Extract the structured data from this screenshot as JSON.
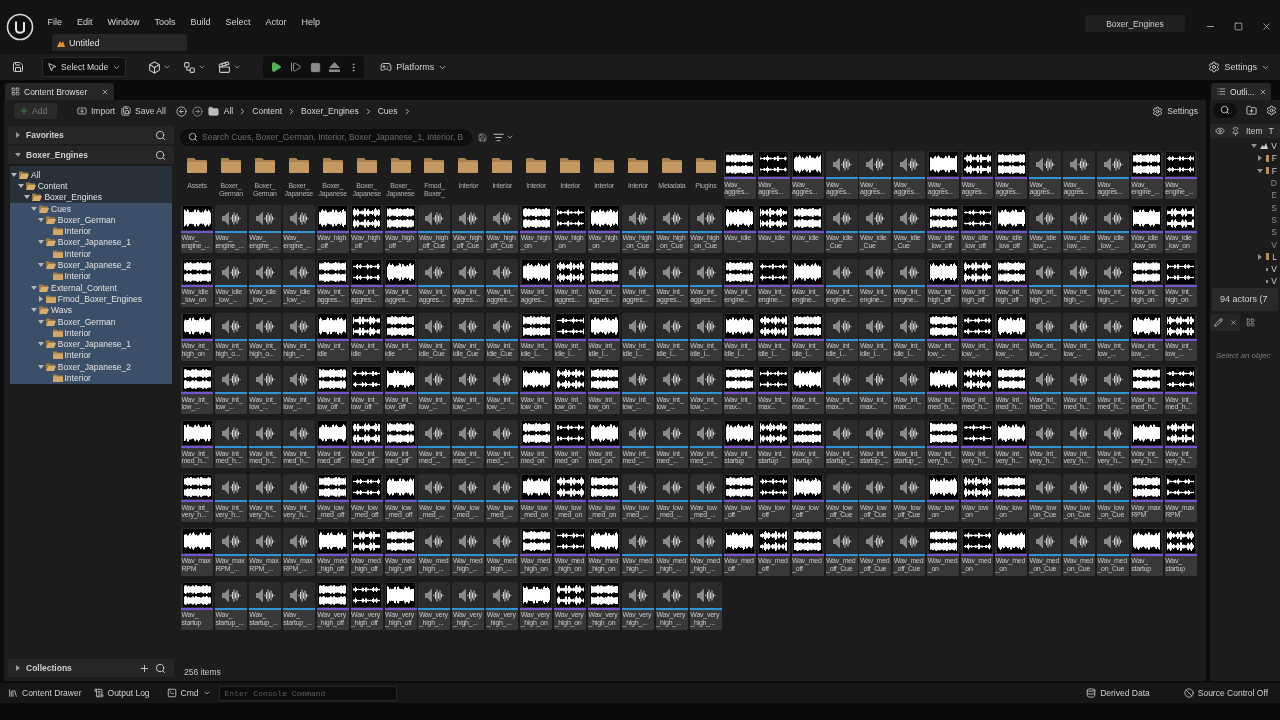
{
  "title_bar": {
    "menu": [
      "File",
      "Edit",
      "Window",
      "Tools",
      "Build",
      "Select",
      "Actor",
      "Help"
    ],
    "document_tab": "Untitled",
    "project_name": "Boxer_Engines"
  },
  "main_toolbar": {
    "mode_button": "Select Mode",
    "platforms_button": "Platforms",
    "settings_button": "Settings"
  },
  "content_browser": {
    "tab": "Content Browser",
    "toolbar": {
      "add_button": {
        "label": "Add",
        "disabled": true
      },
      "import_button": "Import",
      "save_all_button": "Save All",
      "breadcrumbs": [
        "All",
        "Content",
        "Boxer_Engines",
        "Cues"
      ],
      "settings_button": "Settings"
    },
    "sidebar": {
      "favorites_header": "Favorites",
      "tree_header": "Boxer_Engines",
      "tree": [
        {
          "label": "All",
          "expanded": true,
          "selected": false,
          "children": [
            {
              "label": "Content",
              "expanded": true,
              "selected": false,
              "children": [
                {
                  "label": "Boxer_Engines",
                  "expanded": true,
                  "selected": false,
                  "children": [
                    {
                      "label": "Cues",
                      "expanded": true,
                      "selected": true,
                      "children": [
                        {
                          "label": "Boxer_German",
                          "expanded": true,
                          "selected": true,
                          "children": [
                            {
                              "label": "Interior",
                              "selected": true
                            }
                          ]
                        },
                        {
                          "label": "Boxer_Japanese_1",
                          "expanded": true,
                          "selected": true,
                          "children": [
                            {
                              "label": "Interior",
                              "selected": true
                            }
                          ]
                        },
                        {
                          "label": "Boxer_Japanese_2",
                          "expanded": true,
                          "selected": true,
                          "children": [
                            {
                              "label": "Interior",
                              "selected": true
                            }
                          ]
                        }
                      ]
                    },
                    {
                      "label": "External_Content",
                      "expanded": true,
                      "selected": true,
                      "children": [
                        {
                          "label": "Fmod_Boxer_Engines",
                          "expanded": false,
                          "selected": true
                        }
                      ]
                    },
                    {
                      "label": "Wavs",
                      "expanded": true,
                      "selected": true,
                      "children": [
                        {
                          "label": "Boxer_German",
                          "expanded": true,
                          "selected": true,
                          "children": [
                            {
                              "label": "Interior",
                              "selected": true
                            }
                          ]
                        },
                        {
                          "label": "Boxer_Japanese_1",
                          "expanded": true,
                          "selected": true,
                          "children": [
                            {
                              "label": "Interior",
                              "selected": true
                            }
                          ]
                        },
                        {
                          "label": "Boxer_Japanese_2",
                          "expanded": true,
                          "selected": true,
                          "children": [
                            {
                              "label": "Interior",
                              "selected": true
                            }
                          ]
                        }
                      ]
                    }
                  ]
                }
              ]
            }
          ]
        }
      ],
      "collections_header": "Collections"
    },
    "search": {
      "placeholder": "Search Cues, Boxer_German, Interior, Boxer_Japanese_1, Interior, B"
    },
    "items": [
      {
        "kind": "folder",
        "label": "Assets"
      },
      {
        "kind": "folder",
        "label": "Boxer_ German"
      },
      {
        "kind": "folder",
        "label": "Boxer_ German"
      },
      {
        "kind": "folder",
        "label": "Boxer_ Japanese"
      },
      {
        "kind": "folder",
        "label": "Boxer_ Japanese"
      },
      {
        "kind": "folder",
        "label": "Boxer_ Japanese"
      },
      {
        "kind": "folder",
        "label": "Boxer_ Japanese"
      },
      {
        "kind": "folder",
        "label": "Fmod_ Boxer_"
      },
      {
        "kind": "folder",
        "label": "Interior"
      },
      {
        "kind": "folder",
        "label": "Interior"
      },
      {
        "kind": "folder",
        "label": "Interior"
      },
      {
        "kind": "folder",
        "label": "Interior"
      },
      {
        "kind": "folder",
        "label": "Interior"
      },
      {
        "kind": "folder",
        "label": "Interior"
      },
      {
        "kind": "folder",
        "label": "Metadata"
      },
      {
        "kind": "folder",
        "label": "Plugins"
      },
      {
        "kind": "wave",
        "label": "Wav_ aggres..."
      },
      {
        "kind": "wave",
        "label": "Wav_ aggres..."
      },
      {
        "kind": "wave",
        "label": "Wav_ aggres..."
      },
      {
        "kind": "cue",
        "label": "Wav_ aggres..."
      },
      {
        "kind": "cue",
        "label": "Wav_ aggres..."
      },
      {
        "kind": "cue",
        "label": "Wav_ aggres..."
      },
      {
        "kind": "wave",
        "label": "Wav_ aggres..."
      },
      {
        "kind": "wave",
        "label": "Wav_ aggres..."
      },
      {
        "kind": "wave",
        "label": "Wav_ aggres..."
      },
      {
        "kind": "cue",
        "label": "Wav_ aggres..."
      },
      {
        "kind": "cue",
        "label": "Wav_ aggres..."
      },
      {
        "kind": "cue",
        "label": "Wav_ aggres..."
      },
      {
        "kind": "wave",
        "label": "Wav_ engine_..."
      },
      {
        "kind": "wave",
        "label": "Wav_ engine_..."
      },
      {
        "kind": "wave",
        "label": "Wav_ engine_..."
      },
      {
        "kind": "cue",
        "label": "Wav_ engine_..."
      },
      {
        "kind": "cue",
        "label": "Wav_ engine_..."
      },
      {
        "kind": "cue",
        "label": "Wav_ engine_..."
      },
      {
        "kind": "wave",
        "label": "Wav_high _off"
      },
      {
        "kind": "wave",
        "label": "Wav_high _off"
      },
      {
        "kind": "wave",
        "label": "Wav_high _off"
      },
      {
        "kind": "cue",
        "label": "Wav_high _off_Cue"
      },
      {
        "kind": "cue",
        "label": "Wav_high _off_Cue"
      },
      {
        "kind": "cue",
        "label": "Wav_high _off_Cue"
      },
      {
        "kind": "wave",
        "label": "Wav_high _on"
      },
      {
        "kind": "wave",
        "label": "Wav_high _on"
      },
      {
        "kind": "wave",
        "label": "Wav_high _on"
      },
      {
        "kind": "cue",
        "label": "Wav_high _on_Cue"
      },
      {
        "kind": "cue",
        "label": "Wav_high _on_Cue"
      },
      {
        "kind": "cue",
        "label": "Wav_high _on_Cue"
      },
      {
        "kind": "wave",
        "label": "Wav_idle"
      },
      {
        "kind": "wave",
        "label": "Wav_idle"
      },
      {
        "kind": "wave",
        "label": "Wav_idle"
      },
      {
        "kind": "cue",
        "label": "Wav_idle _Cue"
      },
      {
        "kind": "cue",
        "label": "Wav_idle _Cue"
      },
      {
        "kind": "cue",
        "label": "Wav_idle _Cue"
      },
      {
        "kind": "wave",
        "label": "Wav_idle _low_off"
      },
      {
        "kind": "wave",
        "label": "Wav_idle _low_off"
      },
      {
        "kind": "wave",
        "label": "Wav_idle _low_off"
      },
      {
        "kind": "cue",
        "label": "Wav_idle _low_..."
      },
      {
        "kind": "cue",
        "label": "Wav_idle _low_..."
      },
      {
        "kind": "cue",
        "label": "Wav_idle _low_..."
      },
      {
        "kind": "wave",
        "label": "Wav_idle _low_on"
      },
      {
        "kind": "wave",
        "label": "Wav_idle _low_on"
      },
      {
        "kind": "wave",
        "label": "Wav_idle _low_on"
      },
      {
        "kind": "cue",
        "label": "Wav_idle _low_..."
      },
      {
        "kind": "cue",
        "label": "Wav_idle _low_..."
      },
      {
        "kind": "cue",
        "label": "Wav_idle _low_..."
      },
      {
        "kind": "wave",
        "label": "Wav_int_ aggres..."
      },
      {
        "kind": "wave",
        "label": "Wav_int_ aggres..."
      },
      {
        "kind": "wave",
        "label": "Wav_int_ aggres..."
      },
      {
        "kind": "cue",
        "label": "Wav_int_ aggres..."
      },
      {
        "kind": "cue",
        "label": "Wav_int_ aggres..."
      },
      {
        "kind": "cue",
        "label": "Wav_int_ aggres..."
      },
      {
        "kind": "wave",
        "label": "Wav_int_ aggres..."
      },
      {
        "kind": "wave",
        "label": "Wav_int_ aggres..."
      },
      {
        "kind": "wave",
        "label": "Wav_int_ aggres..."
      },
      {
        "kind": "cue",
        "label": "Wav_int_ aggres..."
      },
      {
        "kind": "cue",
        "label": "Wav_int_ aggres..."
      },
      {
        "kind": "cue",
        "label": "Wav_int_ aggres..."
      },
      {
        "kind": "wave",
        "label": "Wav_int_ engine..."
      },
      {
        "kind": "wave",
        "label": "Wav_int_ engine..."
      },
      {
        "kind": "wave",
        "label": "Wav_int_ engine..."
      },
      {
        "kind": "cue",
        "label": "Wav_int_ engine..."
      },
      {
        "kind": "cue",
        "label": "Wav_int_ engine..."
      },
      {
        "kind": "cue",
        "label": "Wav_int_ engine..."
      },
      {
        "kind": "wave",
        "label": "Wav_int_ high_off"
      },
      {
        "kind": "wave",
        "label": "Wav_int_ high_off"
      },
      {
        "kind": "wave",
        "label": "Wav_int_ high_off"
      },
      {
        "kind": "cue",
        "label": "Wav_int_ high_..."
      },
      {
        "kind": "cue",
        "label": "Wav_int_ high_..."
      },
      {
        "kind": "cue",
        "label": "Wav_int_ high_..."
      },
      {
        "kind": "wave",
        "label": "Wav_int_ high_on"
      },
      {
        "kind": "wave",
        "label": "Wav_int_ high_on"
      },
      {
        "kind": "wave",
        "label": "Wav_int_ high_on"
      },
      {
        "kind": "cue",
        "label": "Wav_int_ high_o..."
      },
      {
        "kind": "cue",
        "label": "Wav_int_ high_o..."
      },
      {
        "kind": "cue",
        "label": "Wav_int_ high_..."
      },
      {
        "kind": "wave",
        "label": "Wav_int_ idle"
      },
      {
        "kind": "wave",
        "label": "Wav_int_ idle"
      },
      {
        "kind": "wave",
        "label": "Wav_int_ idle"
      },
      {
        "kind": "cue",
        "label": "Wav_int_ idle_Cue"
      },
      {
        "kind": "cue",
        "label": "Wav_int_ idle_Cue"
      },
      {
        "kind": "cue",
        "label": "Wav_int_ idle_Cue"
      },
      {
        "kind": "wave",
        "label": "Wav_int_ idle_l..."
      },
      {
        "kind": "wave",
        "label": "Wav_int_ idle_l..."
      },
      {
        "kind": "wave",
        "label": "Wav_int_ idle_l..."
      },
      {
        "kind": "cue",
        "label": "Wav_int_ idle_l..."
      },
      {
        "kind": "cue",
        "label": "Wav_int_ idle_l..."
      },
      {
        "kind": "cue",
        "label": "Wav_int_ idle_l..."
      },
      {
        "kind": "wave",
        "label": "Wav_int_ idle_l..."
      },
      {
        "kind": "wave",
        "label": "Wav_int_ idle_l..."
      },
      {
        "kind": "wave",
        "label": "Wav_int_ idle_l..."
      },
      {
        "kind": "cue",
        "label": "Wav_int_ idle_l..."
      },
      {
        "kind": "cue",
        "label": "Wav_int_ idle_l..."
      },
      {
        "kind": "cue",
        "label": "Wav_int_ idle_l..."
      },
      {
        "kind": "wave",
        "label": "Wav_int_ low_..."
      },
      {
        "kind": "wave",
        "label": "Wav_int_ low_..."
      },
      {
        "kind": "wave",
        "label": "Wav_int_ low_..."
      },
      {
        "kind": "cue",
        "label": "Wav_int_ low_..."
      },
      {
        "kind": "cue",
        "label": "Wav_int_ low_..."
      },
      {
        "kind": "cue",
        "label": "Wav_int_ low_..."
      },
      {
        "kind": "wave",
        "label": "Wav_int_ low_..."
      },
      {
        "kind": "wave",
        "label": "Wav_int_ low_..."
      },
      {
        "kind": "wave",
        "label": "Wav_int_ low_..."
      },
      {
        "kind": "cue",
        "label": "Wav_int_ low_..."
      },
      {
        "kind": "cue",
        "label": "Wav_int_ low_..."
      },
      {
        "kind": "cue",
        "label": "Wav_int_ low_..."
      },
      {
        "kind": "wave",
        "label": "Wav_int_ low_off"
      },
      {
        "kind": "wave",
        "label": "Wav_int_ low_off"
      },
      {
        "kind": "wave",
        "label": "Wav_int_ low_off"
      },
      {
        "kind": "cue",
        "label": "Wav_int_ low_..."
      },
      {
        "kind": "cue",
        "label": "Wav_int_ low_..."
      },
      {
        "kind": "cue",
        "label": "Wav_int_ low_..."
      },
      {
        "kind": "wave",
        "label": "Wav_int_ low_on"
      },
      {
        "kind": "wave",
        "label": "Wav_int_ low_on"
      },
      {
        "kind": "wave",
        "label": "Wav_int_ low_on"
      },
      {
        "kind": "cue",
        "label": "Wav_int_ low_..."
      },
      {
        "kind": "cue",
        "label": "Wav_int_ low_..."
      },
      {
        "kind": "cue",
        "label": "Wav_int_ low_..."
      },
      {
        "kind": "wave",
        "label": "Wav_int_ max..."
      },
      {
        "kind": "wave",
        "label": "Wav_int_ max..."
      },
      {
        "kind": "wave",
        "label": "Wav_int_ max..."
      },
      {
        "kind": "cue",
        "label": "Wav_int_ max..."
      },
      {
        "kind": "cue",
        "label": "Wav_int_ max..."
      },
      {
        "kind": "cue",
        "label": "Wav_int_ max..."
      },
      {
        "kind": "wave",
        "label": "Wav_int_ med_h..."
      },
      {
        "kind": "wave",
        "label": "Wav_int_ med_h..."
      },
      {
        "kind": "wave",
        "label": "Wav_int_ med_h..."
      },
      {
        "kind": "cue",
        "label": "Wav_int_ med_h..."
      },
      {
        "kind": "cue",
        "label": "Wav_int_ med_h..."
      },
      {
        "kind": "cue",
        "label": "Wav_int_ med_h..."
      },
      {
        "kind": "wave",
        "label": "Wav_int_ med_h..."
      },
      {
        "kind": "wave",
        "label": "Wav_int_ med_h..."
      },
      {
        "kind": "wave",
        "label": "Wav_int_ med_h..."
      },
      {
        "kind": "cue",
        "label": "Wav_int_ med_h..."
      },
      {
        "kind": "cue",
        "label": "Wav_int_ med_h..."
      },
      {
        "kind": "cue",
        "label": "Wav_int_ med_h..."
      },
      {
        "kind": "wave",
        "label": "Wav_int_ med_off"
      },
      {
        "kind": "wave",
        "label": "Wav_int_ med_off"
      },
      {
        "kind": "wave",
        "label": "Wav_int_ med_off"
      },
      {
        "kind": "cue",
        "label": "Wav_int_ med_..."
      },
      {
        "kind": "cue",
        "label": "Wav_int_ med_..."
      },
      {
        "kind": "cue",
        "label": "Wav_int_ med_..."
      },
      {
        "kind": "wave",
        "label": "Wav_int_ med_on"
      },
      {
        "kind": "wave",
        "label": "Wav_int_ med_on"
      },
      {
        "kind": "wave",
        "label": "Wav_int_ med_on"
      },
      {
        "kind": "cue",
        "label": "Wav_int_ med_..."
      },
      {
        "kind": "cue",
        "label": "Wav_int_ med_..."
      },
      {
        "kind": "cue",
        "label": "Wav_int_ med_..."
      },
      {
        "kind": "wave",
        "label": "Wav_int_ startup"
      },
      {
        "kind": "wave",
        "label": "Wav_int_ startup"
      },
      {
        "kind": "wave",
        "label": "Wav_int_ startup"
      },
      {
        "kind": "cue",
        "label": "Wav_int_ startup_..."
      },
      {
        "kind": "cue",
        "label": "Wav_int_ startup_..."
      },
      {
        "kind": "cue",
        "label": "Wav_int_ startup_..."
      },
      {
        "kind": "wave",
        "label": "Wav_int_ very_h..."
      },
      {
        "kind": "wave",
        "label": "Wav_int_ very_h..."
      },
      {
        "kind": "wave",
        "label": "Wav_int_ very_h..."
      },
      {
        "kind": "cue",
        "label": "Wav_int_ very_h..."
      },
      {
        "kind": "cue",
        "label": "Wav_int_ very_h..."
      },
      {
        "kind": "cue",
        "label": "Wav_int_ very_h..."
      },
      {
        "kind": "wave",
        "label": "Wav_int_ very_h..."
      },
      {
        "kind": "wave",
        "label": "Wav_int_ very_h..."
      },
      {
        "kind": "wave",
        "label": "Wav_int_ very_h..."
      },
      {
        "kind": "cue",
        "label": "Wav_int_ very_h..."
      },
      {
        "kind": "cue",
        "label": "Wav_int_ very_h..."
      },
      {
        "kind": "cue",
        "label": "Wav_int_ very_h..."
      },
      {
        "kind": "wave",
        "label": "Wav_low _med_off"
      },
      {
        "kind": "wave",
        "label": "Wav_low _med_off"
      },
      {
        "kind": "wave",
        "label": "Wav_low _med_off"
      },
      {
        "kind": "cue",
        "label": "Wav_low _med_..."
      },
      {
        "kind": "cue",
        "label": "Wav_low _med_..."
      },
      {
        "kind": "cue",
        "label": "Wav_low _med_..."
      },
      {
        "kind": "wave",
        "label": "Wav_low _med_on"
      },
      {
        "kind": "wave",
        "label": "Wav_low _med_on"
      },
      {
        "kind": "wave",
        "label": "Wav_low _med_on"
      },
      {
        "kind": "cue",
        "label": "Wav_low _med_..."
      },
      {
        "kind": "cue",
        "label": "Wav_low _med_..."
      },
      {
        "kind": "cue",
        "label": "Wav_low _med_..."
      },
      {
        "kind": "wave",
        "label": "Wav_low _off"
      },
      {
        "kind": "wave",
        "label": "Wav_low _off"
      },
      {
        "kind": "wave",
        "label": "Wav_low _off"
      },
      {
        "kind": "cue",
        "label": "Wav_low _off_Cue"
      },
      {
        "kind": "cue",
        "label": "Wav_low _off_Cue"
      },
      {
        "kind": "cue",
        "label": "Wav_low _off_Cue"
      },
      {
        "kind": "wave",
        "label": "Wav_low _on"
      },
      {
        "kind": "wave",
        "label": "Wav_low _on"
      },
      {
        "kind": "wave",
        "label": "Wav_low _on"
      },
      {
        "kind": "cue",
        "label": "Wav_low _on_Cue"
      },
      {
        "kind": "cue",
        "label": "Wav_low _on_Cue"
      },
      {
        "kind": "cue",
        "label": "Wav_low _on_Cue"
      },
      {
        "kind": "wave",
        "label": "Wav_max RPM"
      },
      {
        "kind": "wave",
        "label": "Wav_max RPM"
      },
      {
        "kind": "wave",
        "label": "Wav_max RPM"
      },
      {
        "kind": "cue",
        "label": "Wav_max RPM_..."
      },
      {
        "kind": "cue",
        "label": "Wav_max RPM_..."
      },
      {
        "kind": "cue",
        "label": "Wav_max RPM_..."
      },
      {
        "kind": "wave",
        "label": "Wav_med _high_off"
      },
      {
        "kind": "wave",
        "label": "Wav_med _high_off"
      },
      {
        "kind": "wave",
        "label": "Wav_med _high_off"
      },
      {
        "kind": "cue",
        "label": "Wav_med _high_..."
      },
      {
        "kind": "cue",
        "label": "Wav_med _high_..."
      },
      {
        "kind": "cue",
        "label": "Wav_med _high_..."
      },
      {
        "kind": "wave",
        "label": "Wav_med _high_on"
      },
      {
        "kind": "wave",
        "label": "Wav_med _high_on"
      },
      {
        "kind": "wave",
        "label": "Wav_med _high_on"
      },
      {
        "kind": "cue",
        "label": "Wav_med _high_..."
      },
      {
        "kind": "cue",
        "label": "Wav_med _high_..."
      },
      {
        "kind": "cue",
        "label": "Wav_med _high_..."
      },
      {
        "kind": "wave",
        "label": "Wav_med _off"
      },
      {
        "kind": "wave",
        "label": "Wav_med _off"
      },
      {
        "kind": "wave",
        "label": "Wav_med _off"
      },
      {
        "kind": "cue",
        "label": "Wav_med _off_Cue"
      },
      {
        "kind": "cue",
        "label": "Wav_med _off_Cue"
      },
      {
        "kind": "cue",
        "label": "Wav_med _off_Cue"
      },
      {
        "kind": "wave",
        "label": "Wav_med _on"
      },
      {
        "kind": "wave",
        "label": "Wav_med _on"
      },
      {
        "kind": "wave",
        "label": "Wav_med _on"
      },
      {
        "kind": "cue",
        "label": "Wav_med _on_Cue"
      },
      {
        "kind": "cue",
        "label": "Wav_med _on_Cue"
      },
      {
        "kind": "cue",
        "label": "Wav_med _on_Cue"
      },
      {
        "kind": "wave",
        "label": "Wav_ startup"
      },
      {
        "kind": "wave",
        "label": "Wav_ startup"
      },
      {
        "kind": "wave",
        "label": "Wav_ startup"
      },
      {
        "kind": "cue",
        "label": "Wav_ startup_..."
      },
      {
        "kind": "cue",
        "label": "Wav_ startup_..."
      },
      {
        "kind": "cue",
        "label": "Wav_ startup_..."
      },
      {
        "kind": "wave",
        "label": "Wav_very _high_off"
      },
      {
        "kind": "wave",
        "label": "Wav_very _high_off"
      },
      {
        "kind": "wave",
        "label": "Wav_very _high_off"
      },
      {
        "kind": "cue",
        "label": "Wav_very _high_..."
      },
      {
        "kind": "cue",
        "label": "Wav_very _high_..."
      },
      {
        "kind": "cue",
        "label": "Wav_very _high_..."
      },
      {
        "kind": "wave",
        "label": "Wav_very _high_on"
      },
      {
        "kind": "wave",
        "label": "Wav_very _high_on"
      },
      {
        "kind": "wave",
        "label": "Wav_very _high_on"
      },
      {
        "kind": "cue",
        "label": "Wav_very _high_..."
      },
      {
        "kind": "cue",
        "label": "Wav_very _high_..."
      },
      {
        "kind": "cue",
        "label": "Wav_very _high_..."
      }
    ],
    "item_count": "256 items"
  },
  "outliner": {
    "tab": "Outli...",
    "columns": [
      "Item",
      "T"
    ],
    "rows": [
      {
        "label": "V",
        "kind": "level",
        "expanded": true,
        "children": [
          {
            "label": "F",
            "kind": "folder",
            "expanded": false
          },
          {
            "label": "F",
            "kind": "folder",
            "expanded": true,
            "children": [
              {
                "label": "D",
                "kind": "plain"
              },
              {
                "label": "E",
                "kind": "plain"
              },
              {
                "label": "S",
                "kind": "plain"
              },
              {
                "label": "S",
                "kind": "plain"
              },
              {
                "label": "S",
                "kind": "plain"
              },
              {
                "label": "V",
                "kind": "plain"
              }
            ]
          },
          {
            "label": "L",
            "kind": "folder",
            "expanded": false
          },
          {
            "label": "V",
            "kind": "actor"
          },
          {
            "label": "V",
            "kind": "actor"
          }
        ]
      }
    ],
    "status": "94 actors (7"
  },
  "details": {
    "hint": "Select an objec"
  },
  "status_bar": {
    "content_drawer": "Content Drawer",
    "output_log": "Output Log",
    "cmd": "Cmd",
    "console": {
      "placeholder": "Enter Console Command"
    },
    "derived_data": "Derived Data",
    "source_control": "Source Control Off"
  }
}
